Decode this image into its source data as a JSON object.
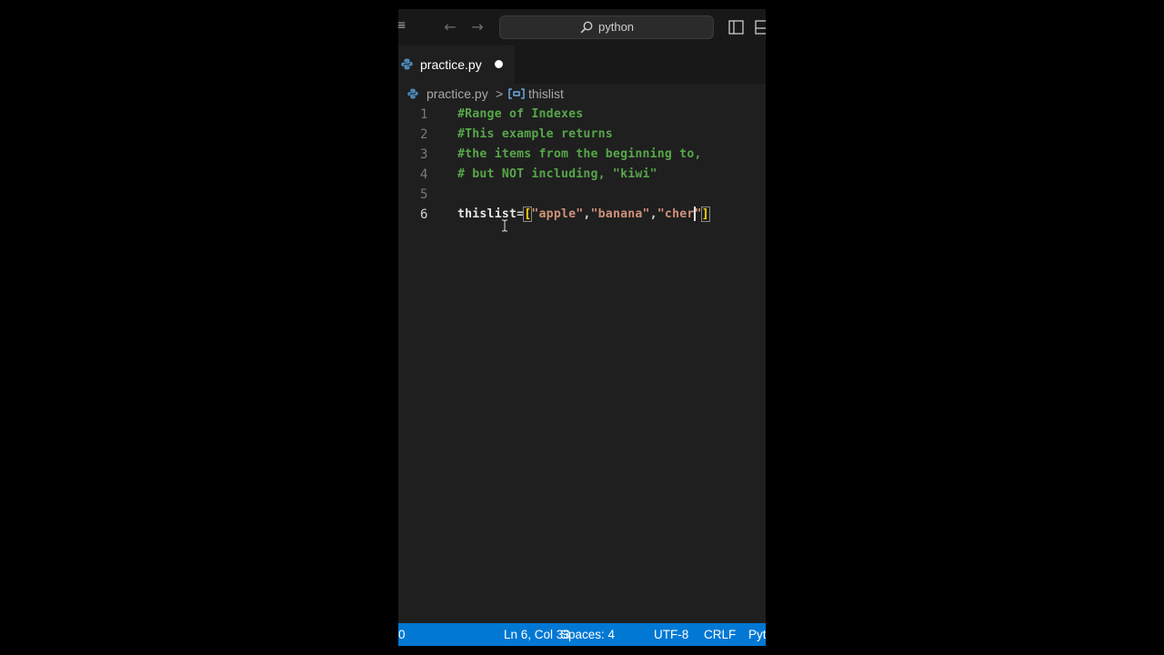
{
  "titlebar": {
    "search_text": "python"
  },
  "tab": {
    "label": "practice.py"
  },
  "breadcrumb": {
    "file": "practice.py",
    "separator": ">",
    "symbol": "thislist"
  },
  "editor": {
    "lines": [
      {
        "number": "1",
        "text": "#Range of Indexes"
      },
      {
        "number": "2",
        "text": "#This example returns"
      },
      {
        "number": "3",
        "text": "#the items from the beginning to,"
      },
      {
        "number": "4",
        "text": "# but NOT including, \"kiwi\""
      },
      {
        "number": "5",
        "text": ""
      },
      {
        "number": "6",
        "var": "thislist",
        "op": "=",
        "open": "[",
        "s1": "\"apple\"",
        "comma1": ",",
        "s2": "\"banana\"",
        "comma2": ",",
        "s3a": "\"cher",
        "s3b": "\"",
        "close": "]"
      }
    ],
    "active_line": 6
  },
  "statusbar": {
    "left": "0",
    "position": "Ln 6, Col 33",
    "spaces": "Spaces: 4",
    "encoding": "UTF-8",
    "eol": "CRLF",
    "language": "Pyt"
  },
  "colors": {
    "statusbar": "#0078d4",
    "comment": "#57a64a",
    "string": "#ce9178",
    "bracket": "#ffd700"
  }
}
